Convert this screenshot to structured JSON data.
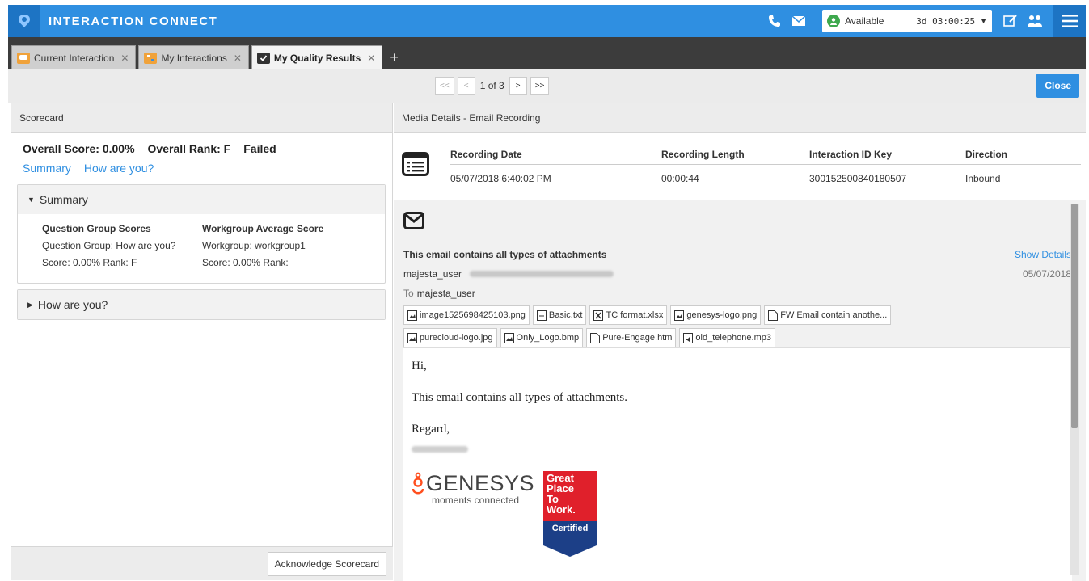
{
  "header": {
    "title": "INTERACTION CONNECT",
    "status_label": "Available",
    "status_time": "3d 03:00:25",
    "icons": [
      "phone-icon",
      "email-icon",
      "compose-icon",
      "users-icon",
      "menu-icon"
    ]
  },
  "tabs": [
    {
      "label": "Current Interaction",
      "active": false
    },
    {
      "label": "My Interactions",
      "active": false
    },
    {
      "label": "My Quality Results",
      "active": true
    }
  ],
  "pager": {
    "first": "<<",
    "prev": "<",
    "indicator": "1 of 3",
    "next": ">",
    "last": ">>",
    "close": "Close"
  },
  "scorecard": {
    "header": "Scorecard",
    "overall_score": "Overall Score: 0.00%",
    "overall_rank": "Overall Rank: F",
    "result": "Failed",
    "links": [
      "Summary",
      "How are you?"
    ],
    "summary_title": "Summary",
    "summary": {
      "col1_header": "Question Group Scores",
      "col1_line1": "Question Group: How are you?",
      "col1_line2": "Score: 0.00%  Rank: F",
      "col2_header": "Workgroup Average Score",
      "col2_line1": "Workgroup: workgroup1",
      "col2_line2": "Score: 0.00%  Rank:"
    },
    "section2_title": "How are you?",
    "acknowledge": "Acknowledge Scorecard"
  },
  "media": {
    "header": "Media Details - Email Recording",
    "columns": [
      "Recording Date",
      "Recording Length",
      "Interaction ID Key",
      "Direction"
    ],
    "values": [
      "05/07/2018 6:40:02 PM",
      "00:00:44",
      "300152500840180507",
      "Inbound"
    ]
  },
  "email": {
    "subject": "This email contains all types of attachments",
    "show_details": "Show Details",
    "from_name": "majesta_user",
    "date": "05/07/2018",
    "to_label": "To",
    "to_name": "majesta_user",
    "attachments_row1": [
      "image1525698425103.png",
      "Basic.txt",
      "TC format.xlsx",
      "genesys-logo.png",
      "FW Email contain anothe..."
    ],
    "attachments_row2": [
      "purecloud-logo.jpg",
      "Only_Logo.bmp",
      "Pure-Engage.htm",
      "old_telephone.mp3"
    ],
    "body_greeting": "Hi,",
    "body_line": "This email contains all types of attachments.",
    "body_regard": "Regard,",
    "sig_brand": "GENESYS",
    "sig_tagline": "moments connected",
    "badge_line1": "Great",
    "badge_line2": "Place",
    "badge_line3": "To",
    "badge_line4": "Work.",
    "badge_certified": "Certified"
  },
  "colors": {
    "brand_blue": "#2f8fe1",
    "status_green": "#3ea84e",
    "badge_red": "#e0202b",
    "badge_blue": "#1c3f87"
  }
}
